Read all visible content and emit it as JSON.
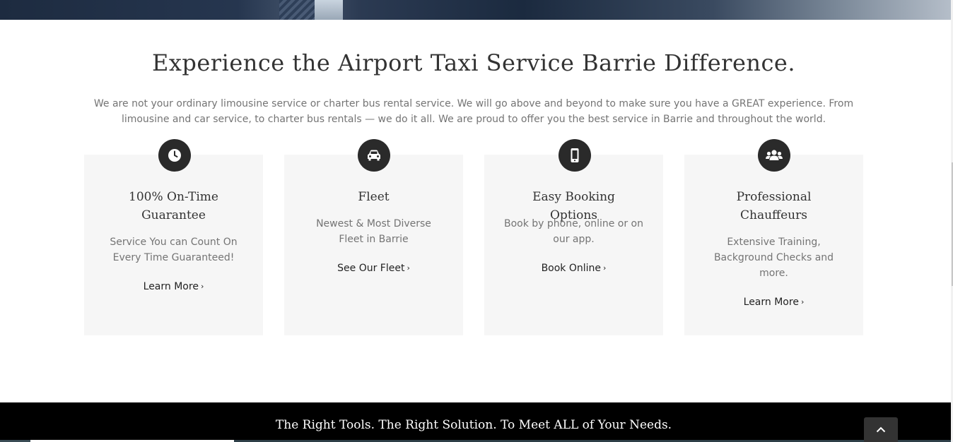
{
  "heading": "Experience the Airport Taxi Service Barrie Difference.",
  "intro": "We are not your ordinary limousine service or charter bus rental service. We will go above and beyond to make sure you have a GREAT experience. From limousine and car service, to charter bus rentals — we do it all. We are proud to offer you the best service in Barrie and throughout the world.",
  "features": [
    {
      "icon": "clock-icon",
      "title": "100% On-Time Guarantee",
      "description": "Service You can Count On Every Time Guaranteed!",
      "link": "Learn More"
    },
    {
      "icon": "car-icon",
      "title": "Fleet",
      "description": "Newest & Most Diverse Fleet in Barrie",
      "link": "See Our Fleet"
    },
    {
      "icon": "mobile-phone-icon",
      "title": "Easy Booking Options",
      "description": "Book by phone, online or on our app.",
      "link": "Book Online"
    },
    {
      "icon": "users-icon",
      "title": "Professional Chauffeurs",
      "description": "Extensive Training, Background Checks and more.",
      "link": "Learn More"
    }
  ],
  "link_chevron": "›",
  "footer": {
    "tagline": "The Right Tools. The Right Solution. To Meet ALL of Your Needs."
  },
  "colors": {
    "icon_bg": "#2a2a2a",
    "card_bg": "#f6f6f6",
    "footer_bg": "#000000",
    "body_text": "#747474"
  }
}
